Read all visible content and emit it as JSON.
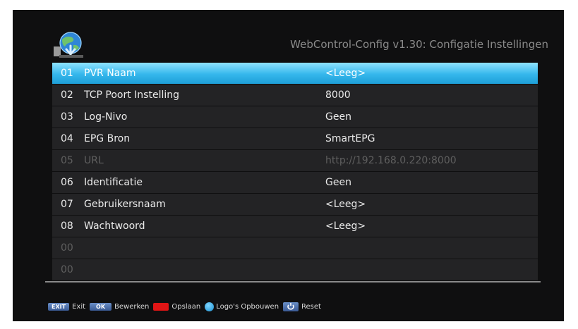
{
  "header": {
    "title": "WebControl-Config v1.30: Configatie Instellingen",
    "logo_icon": "globe-download-icon"
  },
  "rows": [
    {
      "num": "01",
      "label": "PVR Naam",
      "value": "<Leeg>",
      "state": "selected"
    },
    {
      "num": "02",
      "label": "TCP Poort Instelling",
      "value": "8000",
      "state": "normal"
    },
    {
      "num": "03",
      "label": "Log-Nivo",
      "value": "Geen",
      "state": "normal"
    },
    {
      "num": "04",
      "label": "EPG Bron",
      "value": "SmartEPG",
      "state": "normal"
    },
    {
      "num": "05",
      "label": "URL",
      "value": "http://192.168.0.220:8000",
      "state": "disabled"
    },
    {
      "num": "06",
      "label": "Identificatie",
      "value": "Geen",
      "state": "normal"
    },
    {
      "num": "07",
      "label": "Gebruikersnaam",
      "value": "<Leeg>",
      "state": "normal"
    },
    {
      "num": "08",
      "label": "Wachtwoord",
      "value": "<Leeg>",
      "state": "normal"
    },
    {
      "num": "00",
      "label": "",
      "value": "",
      "state": "empty"
    },
    {
      "num": "00",
      "label": "",
      "value": "",
      "state": "empty"
    }
  ],
  "footer": {
    "exit_key": "EXIT",
    "exit_label": "Exit",
    "ok_key": "OK",
    "ok_label": "Bewerken",
    "red_label": "Opslaan",
    "blue_label": "Logo's Opbouwen",
    "reset_label": "Reset"
  },
  "colors": {
    "background": "#0f0f10",
    "row": "#232325",
    "selected": "#35b7ec",
    "red_key": "#e01515",
    "blue_key": "#1a8fd0"
  }
}
